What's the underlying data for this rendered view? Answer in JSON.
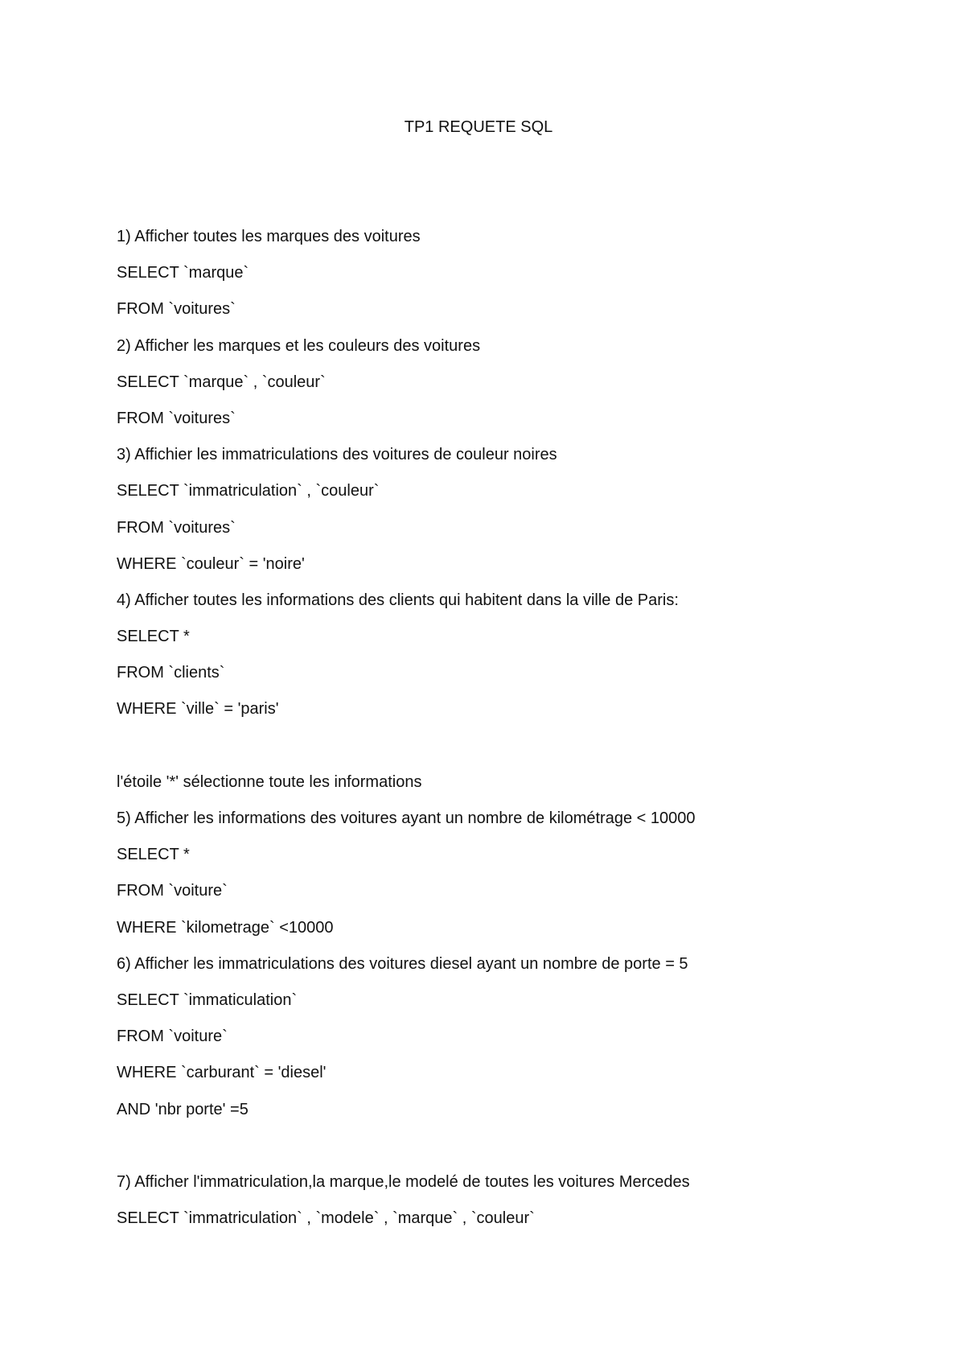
{
  "document": {
    "title": "TP1 REQUETE SQL",
    "lines": [
      "1) Afficher toutes les marques des voitures",
      "SELECT `marque`",
      "FROM `voitures`",
      "2) Afficher les marques et les couleurs des voitures",
      "SELECT `marque` , `couleur`",
      "FROM `voitures`",
      "3) Affichier les immatriculations des voitures de couleur noires",
      "SELECT `immatriculation` , `couleur`",
      "FROM `voitures`",
      "WHERE `couleur` = 'noire'",
      "4) Afficher toutes les informations des clients qui habitent dans la ville de Paris:",
      "SELECT *",
      "FROM `clients`",
      "WHERE `ville` = 'paris'",
      "",
      "l'étoile '*' sélectionne toute les informations",
      "5) Afficher les informations des voitures ayant un nombre de kilométrage < 10000",
      "SELECT *",
      "FROM `voiture`",
      "WHERE `kilometrage` <10000",
      "6) Afficher les immatriculations des voitures diesel ayant un nombre de porte = 5",
      "SELECT `immaticulation`",
      "FROM `voiture`",
      "WHERE `carburant` = 'diesel'",
      "AND 'nbr porte' =5",
      "",
      "7) Afficher l'immatriculation,la marque,le modelé de toutes les voitures Mercedes",
      "SELECT `immatriculation` , `modele` , `marque` , `couleur`"
    ]
  }
}
